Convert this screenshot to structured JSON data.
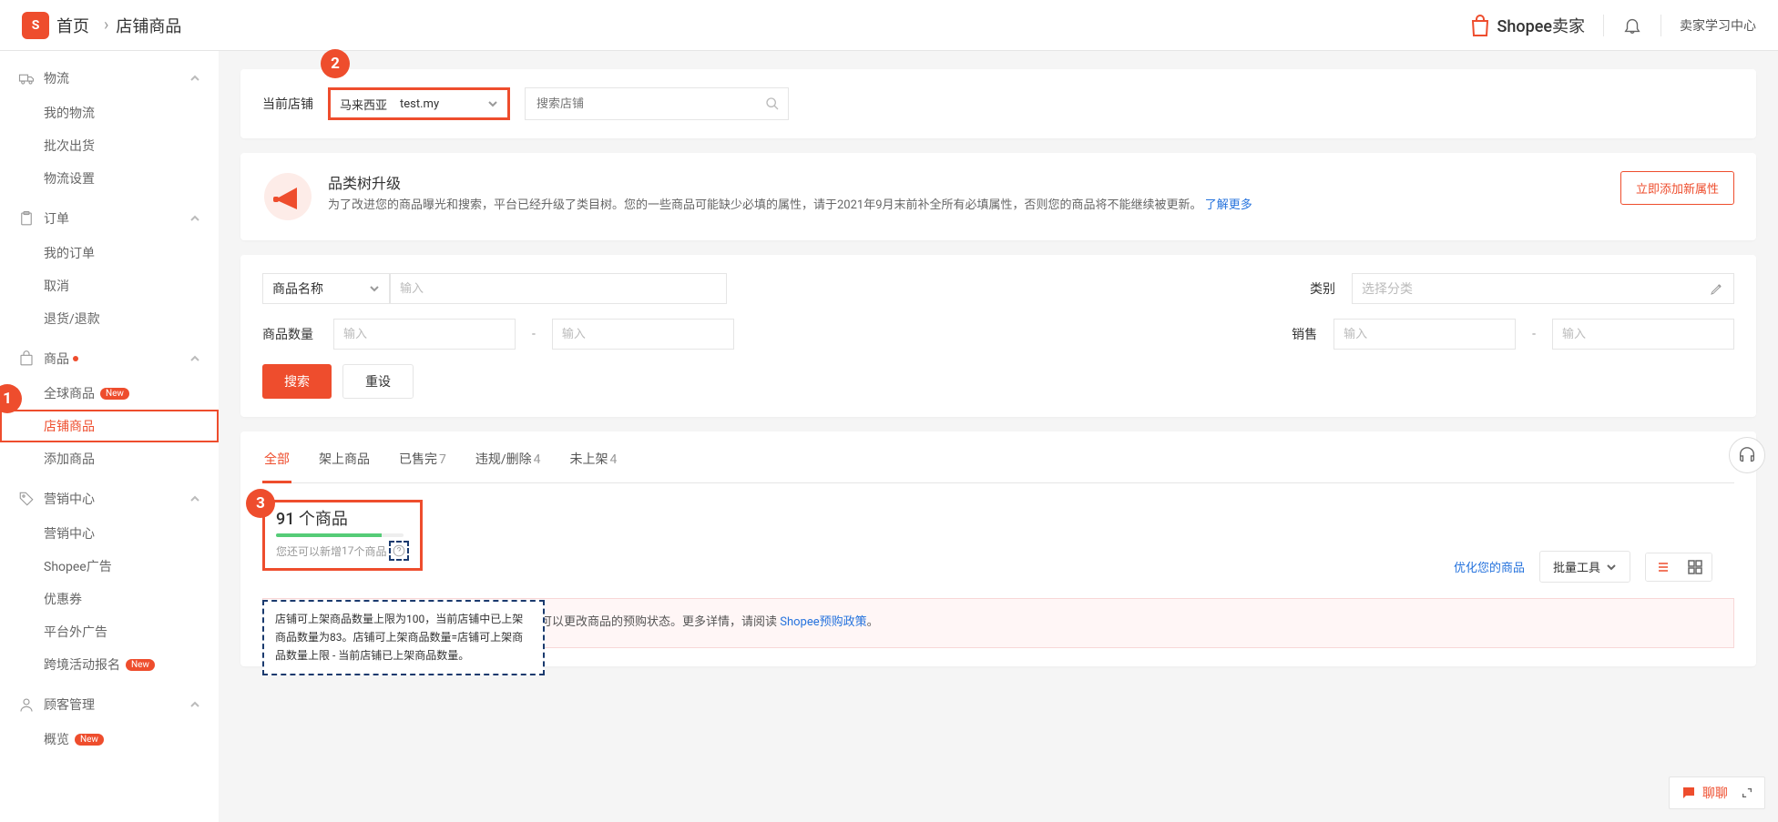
{
  "header": {
    "home": "首页",
    "current": "店铺商品",
    "brand": "Shopee卖家",
    "learn_center": "卖家学习中心"
  },
  "sidebar": {
    "logistics": {
      "header": "物流",
      "my_logistics": "我的物流",
      "batch_ship": "批次出货",
      "settings": "物流设置"
    },
    "orders": {
      "header": "订单",
      "my_orders": "我的订单",
      "cancel": "取消",
      "returns": "退货/退款"
    },
    "products": {
      "header": "商品",
      "global": "全球商品",
      "global_badge": "New",
      "shop_products": "店铺商品",
      "add": "添加商品"
    },
    "marketing": {
      "header": "营销中心",
      "center": "营销中心",
      "ads": "Shopee广告",
      "coupons": "优惠券",
      "offsite": "平台外广告",
      "event_signup": "跨境活动报名",
      "event_badge": "New"
    },
    "customers": {
      "header": "顾客管理",
      "overview": "概览",
      "overview_badge": "New"
    }
  },
  "shop_bar": {
    "label": "当前店铺",
    "region": "马来西亚",
    "shop_name": "test.my",
    "search_placeholder": "搜索店铺"
  },
  "notice": {
    "title": "品类树升级",
    "desc": "为了改进您的商品曝光和搜索，平台已经升级了类目树。您的一些商品可能缺少必填的属性，请于2021年9月末前补全所有必填属性，否则您的商品将不能继续被更新。",
    "learn_more": "了解更多",
    "button": "立即添加新属性"
  },
  "search": {
    "name_field_label": "商品名称",
    "name_placeholder": "输入",
    "category_label": "类别",
    "category_placeholder": "选择分类",
    "qty_label": "商品数量",
    "qty_min_ph": "输入",
    "qty_max_ph": "输入",
    "sales_label": "销售",
    "sales_min_ph": "输入",
    "sales_max_ph": "输入",
    "btn_search": "搜索",
    "btn_reset": "重设"
  },
  "tabs": {
    "all": "全部",
    "on_shelf": "架上商品",
    "sold_out": "已售完",
    "sold_out_count": "7",
    "violation": "违规/删除",
    "violation_count": "4",
    "unlisted": "未上架",
    "unlisted_count": "4"
  },
  "summary": {
    "count_text": "91 个商品",
    "remain_prefix": "您还可以新增 ",
    "remain_count": "17",
    "remain_suffix": " 个商品",
    "optimize": "优化您的商品",
    "batch": "批量工具",
    "tooltip": "店铺可上架商品数量上限为100，当前店铺中已上架商品数量为83。店铺可上架商品数量=店铺可上架商品数量上限 - 当前店铺已上架商品数量。"
  },
  "banner": {
    "text": "品总数中的预购商品数量比例将在每小时刷新。您可以更改商品的预购状态。更多详情，请阅读 ",
    "link": "Shopee预购政策",
    "period": "。"
  },
  "chat": {
    "label": "聊聊"
  }
}
